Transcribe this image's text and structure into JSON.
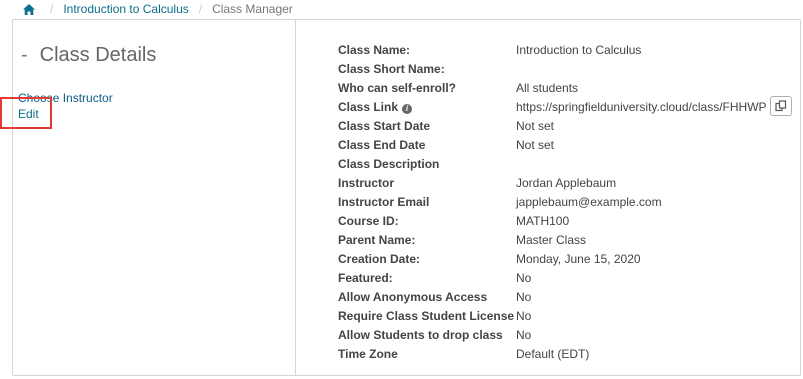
{
  "breadcrumb": {
    "home_icon": "home-icon",
    "items": [
      "Introduction to Calculus",
      "Class Manager"
    ],
    "separator": "/"
  },
  "left_panel": {
    "title": "Class Details",
    "dash": "-",
    "choose_instructor": "Choose Instructor",
    "edit": "Edit"
  },
  "details": {
    "rows": [
      {
        "label": "Class Name:",
        "value": "Introduction to Calculus"
      },
      {
        "label": "Class Short Name:",
        "value": ""
      },
      {
        "label": "Who can self-enroll?",
        "value": "All students"
      },
      {
        "label": "Class Link",
        "value": "https://springfielduniversity.cloud/class/FHHWP"
      },
      {
        "label": "Class Start Date",
        "value": "Not set"
      },
      {
        "label": "Class End Date",
        "value": "Not set"
      },
      {
        "label": "Class Description",
        "value": ""
      },
      {
        "label": "Instructor",
        "value": "Jordan Applebaum"
      },
      {
        "label": "Instructor Email",
        "value": "japplebaum@example.com"
      },
      {
        "label": "Course ID:",
        "value": "MATH100"
      },
      {
        "label": "Parent Name:",
        "value": "Master Class"
      },
      {
        "label": "Creation Date:",
        "value": "Monday, June 15, 2020"
      },
      {
        "label": "Featured:",
        "value": "No"
      },
      {
        "label": "Allow Anonymous Access",
        "value": "No"
      },
      {
        "label": "Require Class Student License",
        "value": "No"
      },
      {
        "label": "Allow Students to drop class",
        "value": "No"
      },
      {
        "label": "Time Zone",
        "value": "Default (EDT)"
      }
    ],
    "info_icon": "info-icon",
    "copy_icon": "copy-icon"
  },
  "colors": {
    "link": "#0b6e8a",
    "highlight": "#e53935",
    "border": "#d6d6d6"
  }
}
